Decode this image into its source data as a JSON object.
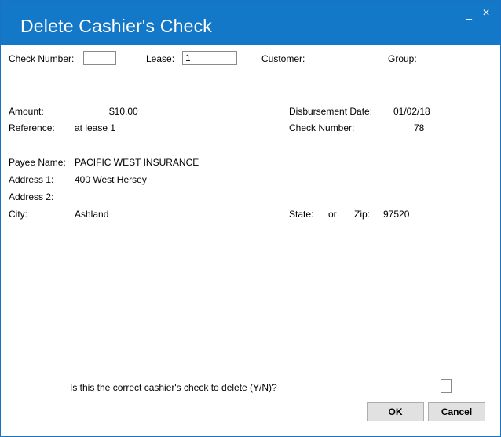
{
  "window": {
    "title": "Delete Cashier's Check",
    "minimize_glyph": "_",
    "close_glyph": "×"
  },
  "search": {
    "check_number_label": "Check Number:",
    "check_number_value": "",
    "lease_label": "Lease:",
    "lease_value": "1",
    "customer_label": "Customer:",
    "group_label": "Group:"
  },
  "details": {
    "amount_label": "Amount:",
    "amount_value": "$10.00",
    "reference_label": "Reference:",
    "reference_value": "at lease 1",
    "disbursement_date_label": "Disbursement Date:",
    "disbursement_date_value": "01/02/18",
    "check_number_label": "Check Number:",
    "check_number_value": "78"
  },
  "payee": {
    "name_label": "Payee Name:",
    "name_value": "PACIFIC WEST INSURANCE",
    "address1_label": "Address 1:",
    "address1_value": "400 West Hersey",
    "address2_label": "Address 2:",
    "address2_value": "",
    "city_label": "City:",
    "city_value": "Ashland",
    "state_label": "State:",
    "state_value": "or",
    "zip_label": "Zip:",
    "zip_value": "97520"
  },
  "confirm": {
    "prompt": "Is this the correct cashier's check to delete (Y/N)?",
    "answer_value": "",
    "ok_label": "OK",
    "cancel_label": "Cancel"
  },
  "colors": {
    "titlebar": "#1478c8"
  }
}
